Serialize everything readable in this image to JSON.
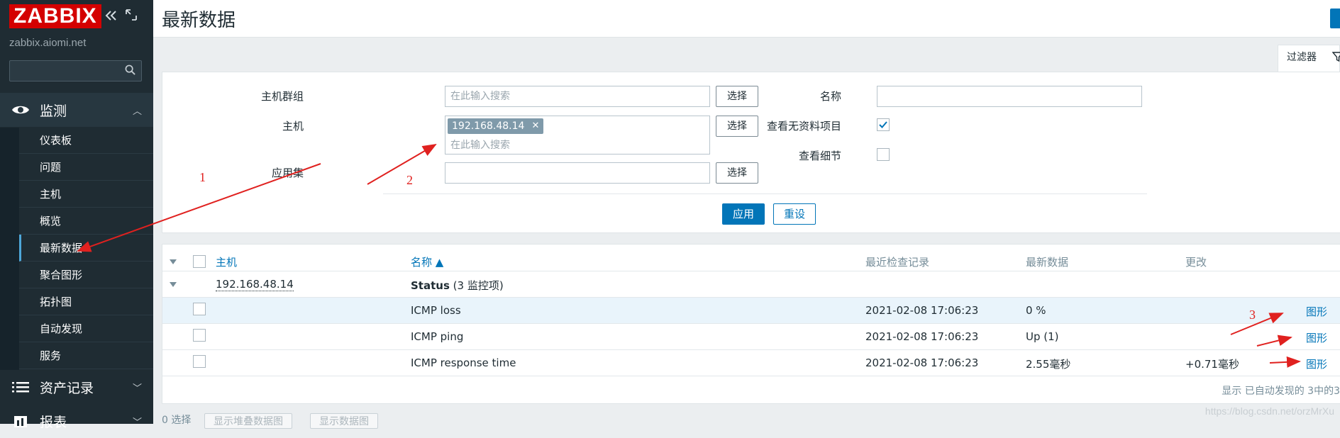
{
  "app": {
    "logo_text": "ZABBIX",
    "server_name": "zabbix.aiomi.net",
    "sidebar_search_placeholder": ""
  },
  "sidebar": {
    "monitoring_label": "监测",
    "items": [
      {
        "label": "仪表板"
      },
      {
        "label": "问题"
      },
      {
        "label": "主机"
      },
      {
        "label": "概览"
      },
      {
        "label": "最新数据"
      },
      {
        "label": "聚合图形"
      },
      {
        "label": "拓扑图"
      },
      {
        "label": "自动发现"
      },
      {
        "label": "服务"
      }
    ],
    "inventory_label": "资产记录",
    "reports_label": "报表"
  },
  "header": {
    "title": "最新数据"
  },
  "filter": {
    "tab_label": "过滤器",
    "host_group_label": "主机群组",
    "host_group_placeholder": "在此输入搜索",
    "host_label": "主机",
    "host_chip": "192.168.48.14",
    "host_placeholder": "在此输入搜索",
    "application_label": "应用集",
    "application_value": "",
    "select_label": "选择",
    "name_label": "名称",
    "name_value": "",
    "show_without_data_label": "查看无资料项目",
    "show_without_data_checked": true,
    "show_details_label": "查看细节",
    "show_details_checked": false,
    "apply_label": "应用",
    "reset_label": "重设"
  },
  "table": {
    "headers": {
      "host": "主机",
      "name": "名称 ▲",
      "last_check": "最近检查记录",
      "last_value": "最新数据",
      "change": "更改"
    },
    "group": {
      "host": "192.168.48.14",
      "app_name": "Status",
      "app_count": "(3 监控项)"
    },
    "rows": [
      {
        "name": "ICMP loss",
        "last_check": "2021-02-08 17:06:23",
        "last_value": "0 %",
        "change": "",
        "graph": "图形"
      },
      {
        "name": "ICMP ping",
        "last_check": "2021-02-08 17:06:23",
        "last_value": "Up (1)",
        "change": "",
        "graph": "图形"
      },
      {
        "name": "ICMP response time",
        "last_check": "2021-02-08 17:06:23",
        "last_value": "2.55毫秒",
        "change": "+0.71毫秒",
        "graph": "图形"
      }
    ],
    "footer": "显示 已自动发现的 3中的3"
  },
  "bottom": {
    "selected_count": "0 选择",
    "btn_stacked_graph": "显示堆叠数据图",
    "btn_graph": "显示数据图"
  },
  "watermark": "https://blog.csdn.net/orzMrXu",
  "annotations": {
    "labels": [
      "1",
      "2",
      "3"
    ],
    "color": "#e0211f"
  },
  "colors": {
    "sidebar_bg": "#1f2c33",
    "accent": "#0275b8",
    "logo_red": "#d40000",
    "chip_bg": "#7f9aaa"
  }
}
